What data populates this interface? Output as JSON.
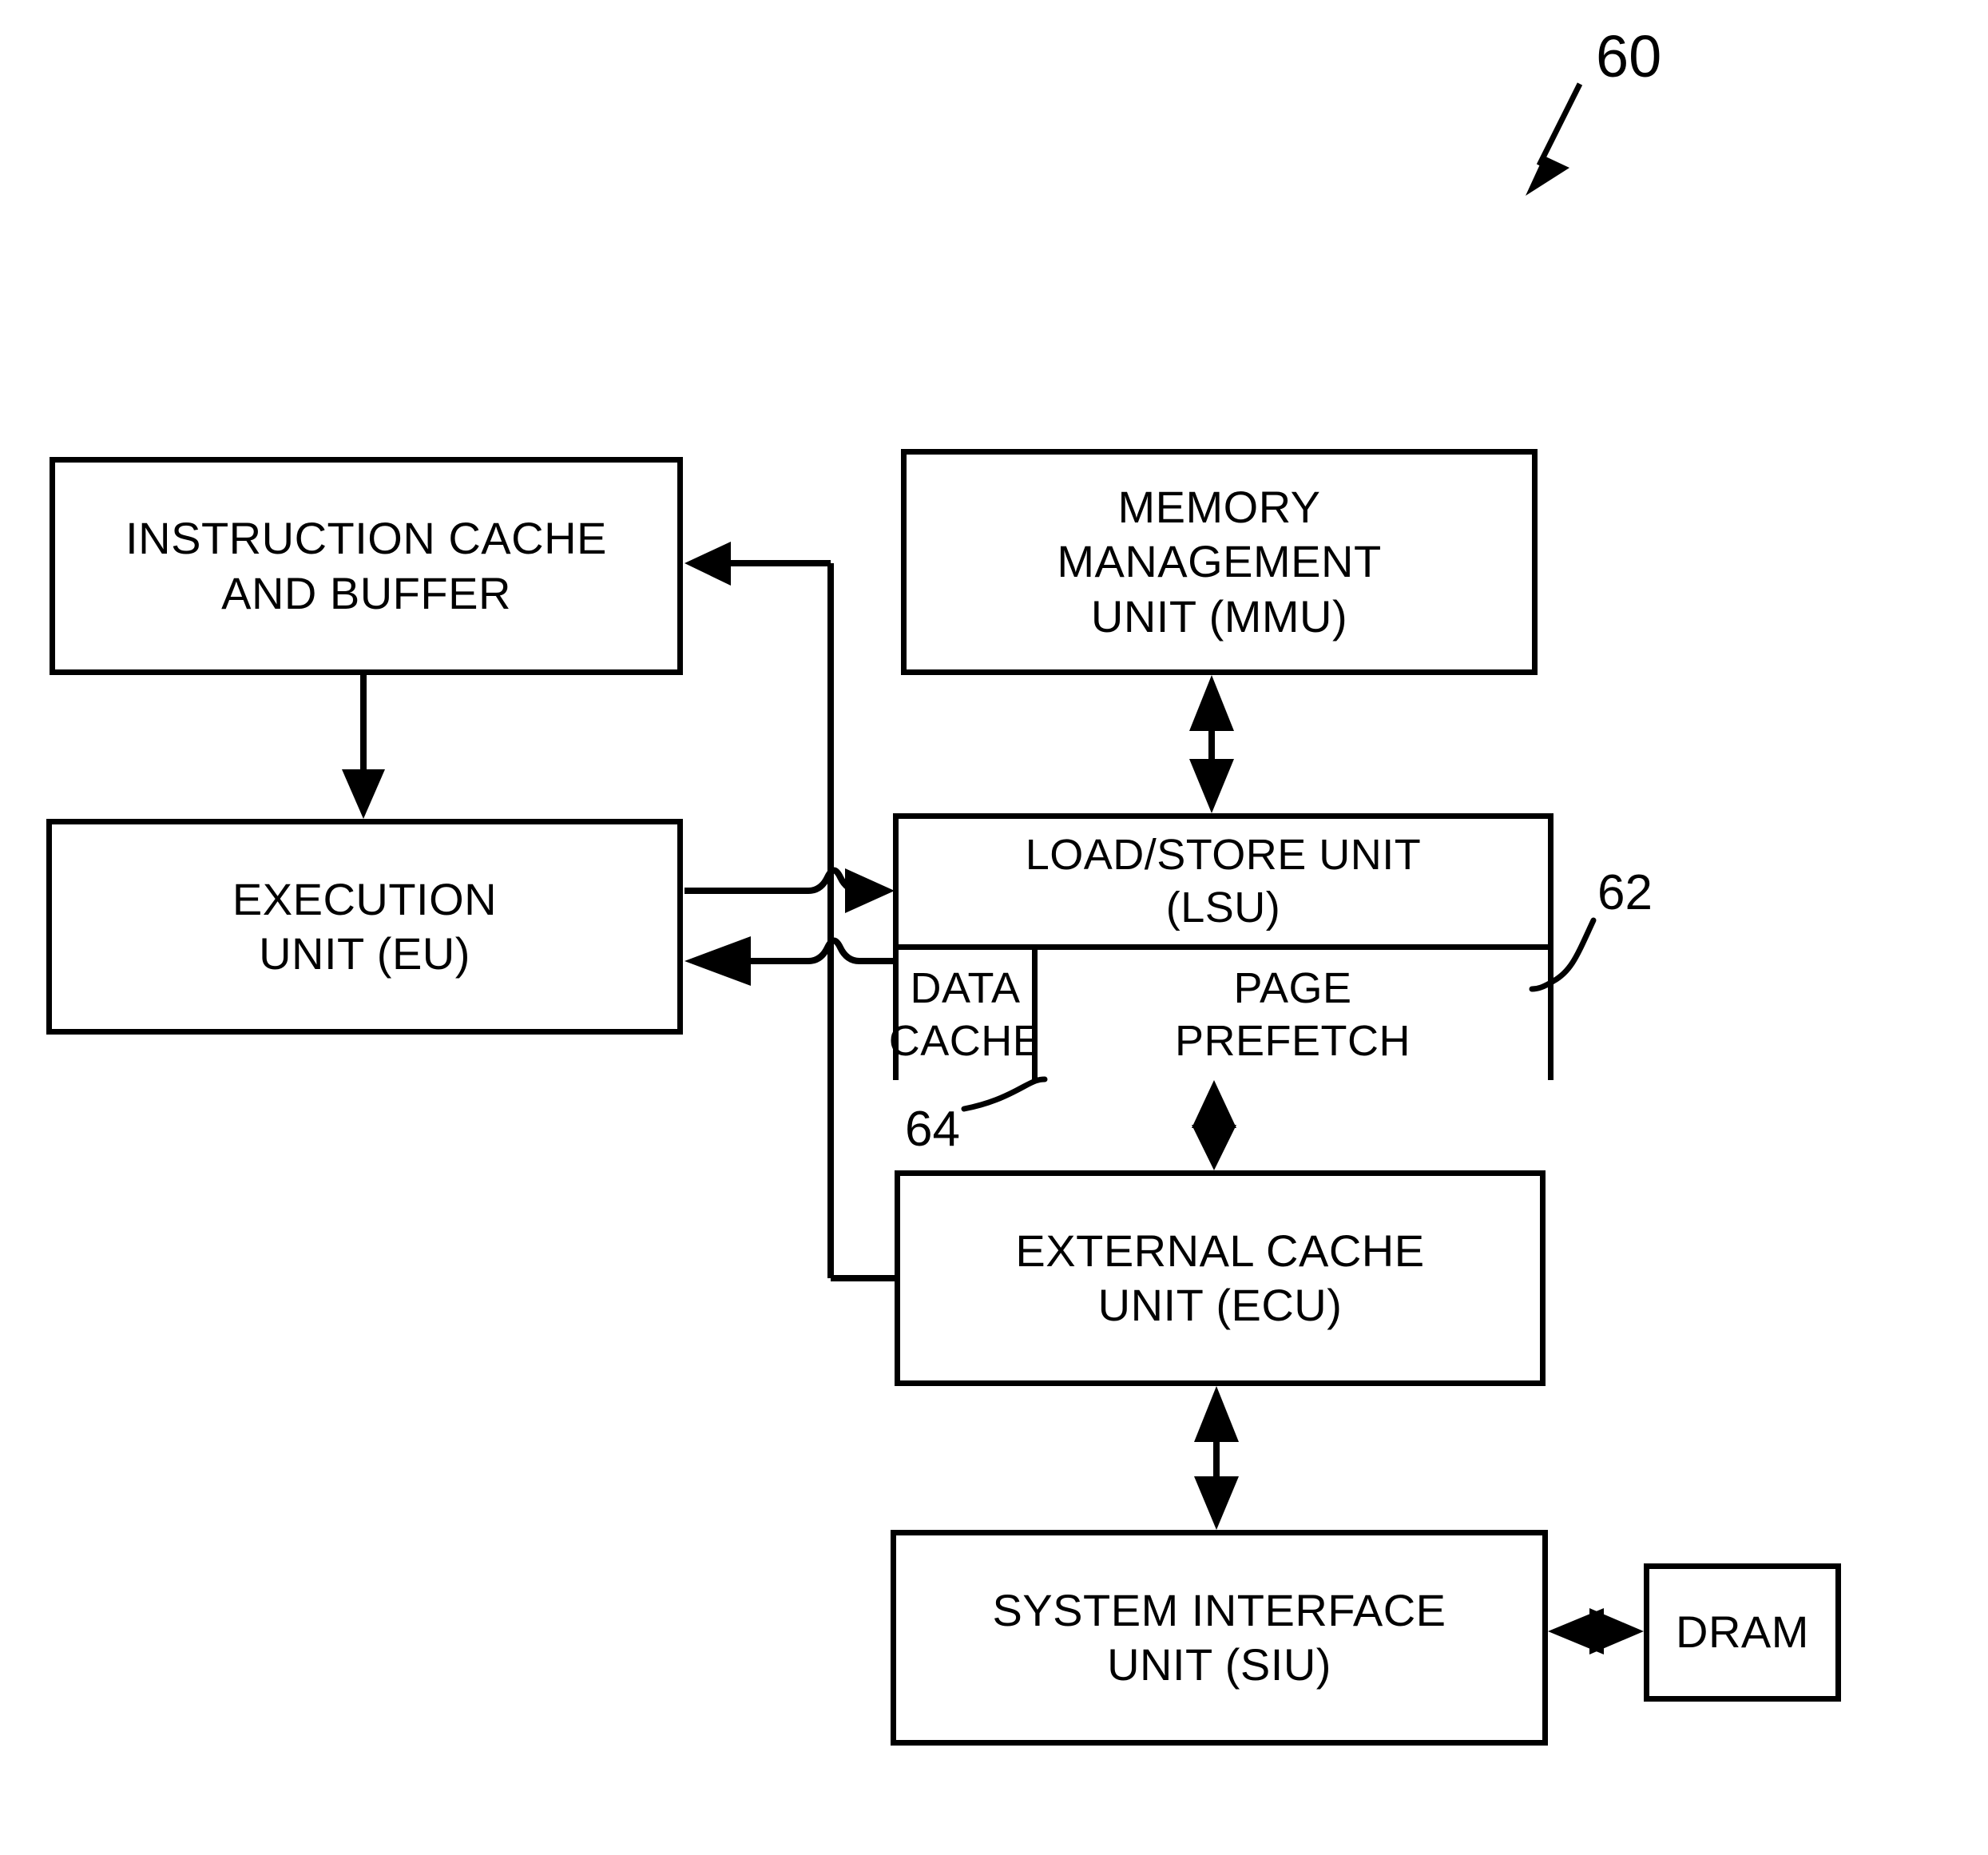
{
  "figure": {
    "reference_numeral": "60",
    "blocks": [
      {
        "id": "instruction-cache",
        "label": "INSTRUCTION CACHE\nAND BUFFER"
      },
      {
        "id": "memory-management-unit",
        "label": "MEMORY\nMANAGEMENT\nUNIT (MMU)"
      },
      {
        "id": "execution-unit",
        "label": "EXECUTION\nUNIT (EU)"
      },
      {
        "id": "load-store-unit",
        "label": "LOAD/STORE UNIT\n(LSU)"
      },
      {
        "id": "data-cache",
        "label": "DATA\nCACHE"
      },
      {
        "id": "page-prefetch",
        "label": "PAGE\nPREFETCH"
      },
      {
        "id": "external-cache-unit",
        "label": "EXTERNAL CACHE\nUNIT (ECU)"
      },
      {
        "id": "system-interface-unit",
        "label": "SYSTEM INTERFACE\nUNIT (SIU)"
      },
      {
        "id": "dram",
        "label": "DRAM"
      }
    ],
    "callouts": [
      {
        "id": "callout-62",
        "label": "62",
        "points_to": "load-store-unit"
      },
      {
        "id": "callout-64",
        "label": "64",
        "points_to": "data-cache"
      }
    ],
    "colors": {
      "stroke": "#000000",
      "fill": "#ffffff"
    }
  }
}
